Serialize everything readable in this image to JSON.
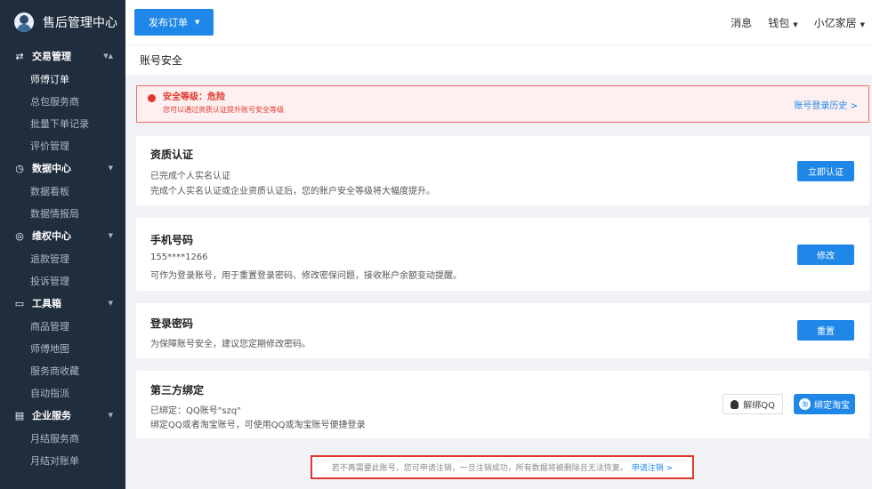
{
  "app": {
    "title": "售后管理中心"
  },
  "sidebar": {
    "groups": [
      {
        "icon": "⇄",
        "label": "交易管理",
        "caret": "▼▲",
        "items": [
          "师傅订单",
          "总包服务商",
          "批量下单记录",
          "评价管理"
        ]
      },
      {
        "icon": "◷",
        "label": "数据中心",
        "caret": "▼",
        "items": [
          "数据看板",
          "数据情报局"
        ]
      },
      {
        "icon": "◎",
        "label": "维权中心",
        "caret": "▼",
        "items": [
          "退款管理",
          "投诉管理"
        ]
      },
      {
        "icon": "▭",
        "label": "工具箱",
        "caret": "▼",
        "items": [
          "商品管理",
          "师傅地图",
          "服务商收藏",
          "自动指派"
        ]
      },
      {
        "icon": "▤",
        "label": "企业服务",
        "caret": "▼",
        "items": [
          "月结服务商",
          "月结对账单"
        ]
      }
    ]
  },
  "topbar": {
    "publish_label": "发布订单",
    "message": "消息",
    "wallet": "钱包",
    "user": "小亿家居",
    "caret": "▼"
  },
  "page": {
    "title": "账号安全"
  },
  "alert": {
    "level_text": "安全等级：危险",
    "hint": "您可以通过资质认证提升账号安全等级",
    "history_link": "账号登录历史 >"
  },
  "cards": {
    "qualification": {
      "title": "资质认证",
      "line1": "已完成个人实名认证",
      "line2": "完成个人实名认证或企业资质认证后，您的账户安全等级将大幅度提升。",
      "button": "立即认证"
    },
    "phone": {
      "title": "手机号码",
      "line1": "155****1266",
      "line2": "可作为登录账号，用于重置登录密码、修改密保问题，接收账户余额变动提醒。",
      "button": "修改"
    },
    "password": {
      "title": "登录密码",
      "line1": "为保障账号安全，建议您定期修改密码。",
      "button": "重置"
    },
    "third_party": {
      "title": "第三方绑定",
      "line1": "已绑定：QQ账号\"szq\"",
      "line2": "绑定QQ或者淘宝账号，可使用QQ或淘宝账号便捷登录",
      "unbind_qq": "解绑QQ",
      "bind_taobao": "绑定淘宝",
      "taobao_icon_glyph": "淘"
    }
  },
  "footer": {
    "notice": "若不再需要此账号，您可申请注销，一旦注销成功，所有数据将被删除且无法恢复。",
    "apply_link": "申请注销 >"
  }
}
